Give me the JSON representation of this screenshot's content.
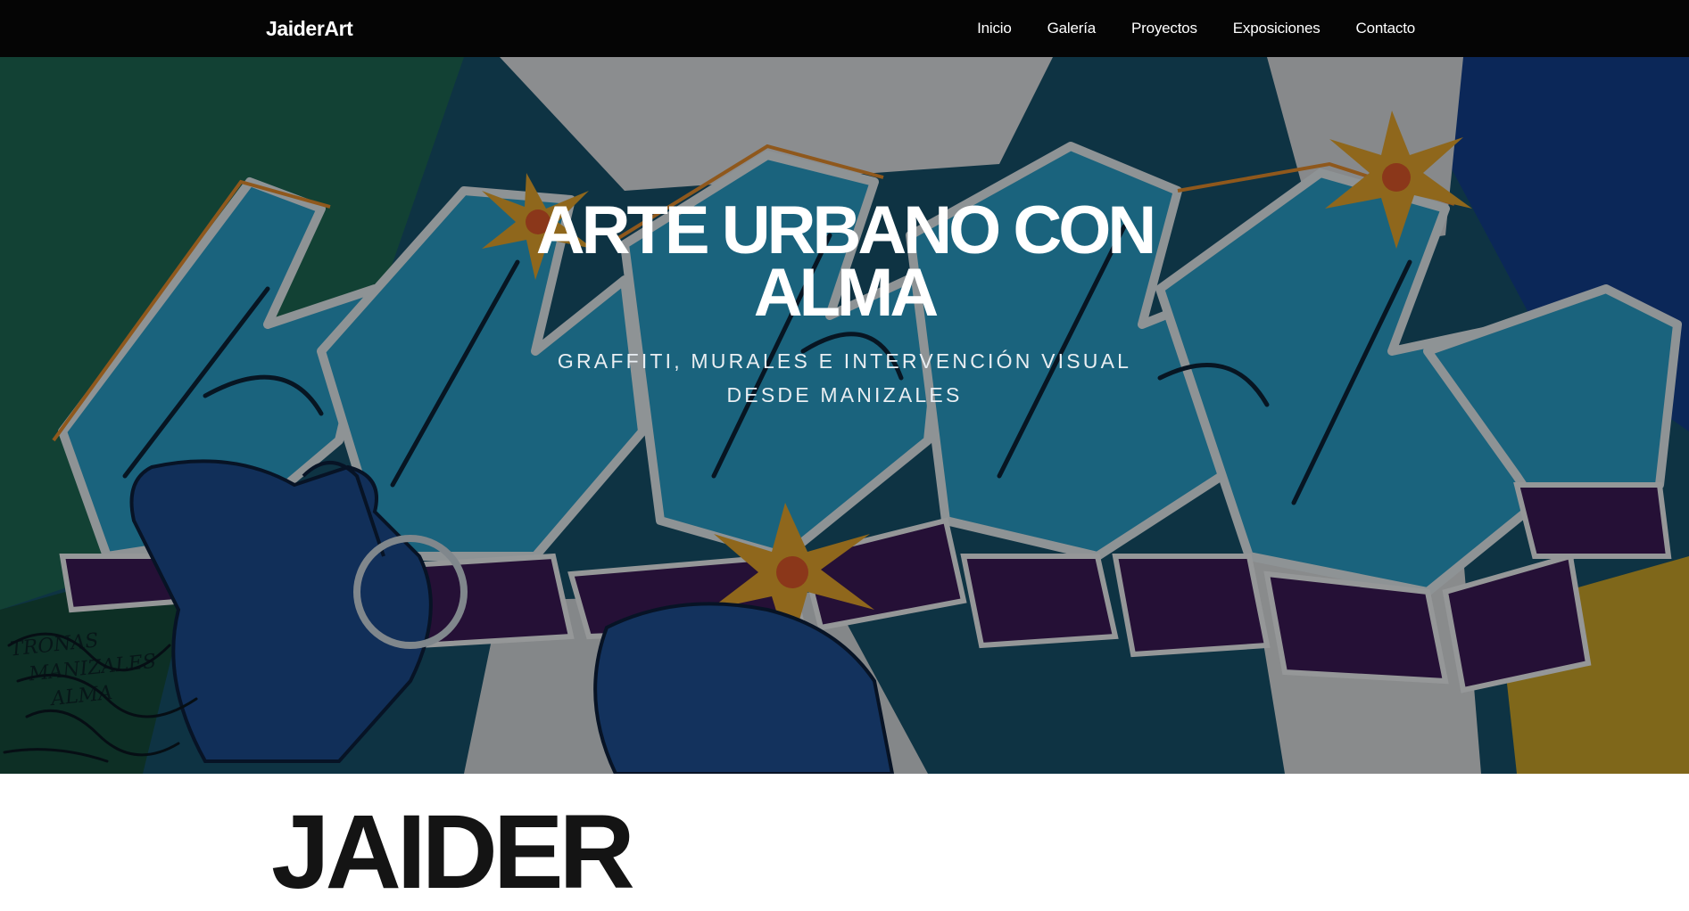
{
  "navbar": {
    "brand": "JaiderArt",
    "links": [
      "Inicio",
      "Galería",
      "Proyectos",
      "Exposiciones",
      "Contacto"
    ]
  },
  "hero": {
    "title": "ARTE URBANO CON ALMA",
    "subtitle": "GRAFFITI, MURALES E INTERVENCIÓN VISUAL DESDE MANIZALES",
    "background_image": "graffiti-mural",
    "mural_tag_lines": [
      "TRONAS",
      "MANIZALES",
      "ALMA"
    ]
  },
  "about": {
    "heading": "JAIDER"
  },
  "colors": {
    "nav_bg": "#050505",
    "text_light": "#ffffff",
    "mural_teal": "#2a9cc4",
    "mural_purple": "#3b1a55",
    "mural_orange": "#e08a2c",
    "mural_green": "#1f6b4e",
    "heading_dark": "#141414"
  }
}
